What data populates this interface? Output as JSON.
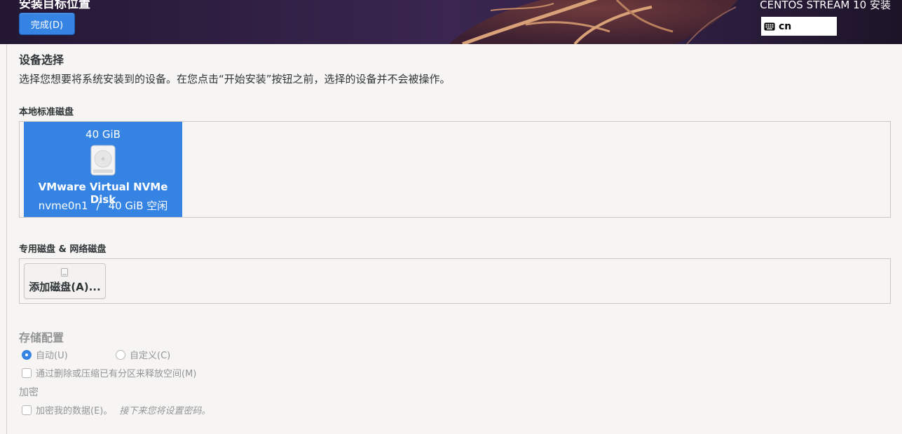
{
  "header": {
    "title": "安装目标位置",
    "done_button": "完成(D)",
    "product": "CENTOS STREAM 10 安装",
    "keyboard_layout": "cn"
  },
  "device_selection": {
    "heading": "设备选择",
    "description": "选择您想要将系统安装到的设备。在您点击“开始安装”按钮之前，选择的设备并不会被操作。"
  },
  "local_disks": {
    "heading": "本地标准磁盘",
    "disks": [
      {
        "size": "40 GiB",
        "name": "VMware Virtual NVMe Disk",
        "device": "nvme0n1",
        "separator": "/",
        "free": "40 GiB 空闲",
        "selected": true
      }
    ]
  },
  "special_disks": {
    "heading": "专用磁盘 & 网络磁盘",
    "add_button": "添加磁盘(A)..."
  },
  "storage_config": {
    "heading": "存储配置",
    "automatic": "自动(U)",
    "custom": "自定义(C)",
    "reclaim": "通过删除或压缩已有分区来释放空间(M)"
  },
  "encryption": {
    "heading": "加密",
    "encrypt_label": "加密我的数据(E)。",
    "hint": "接下来您将设置密码。"
  },
  "colors": {
    "accent": "#3584e4",
    "header_bg": "#2b1d3c",
    "background": "#f6f5f4"
  }
}
